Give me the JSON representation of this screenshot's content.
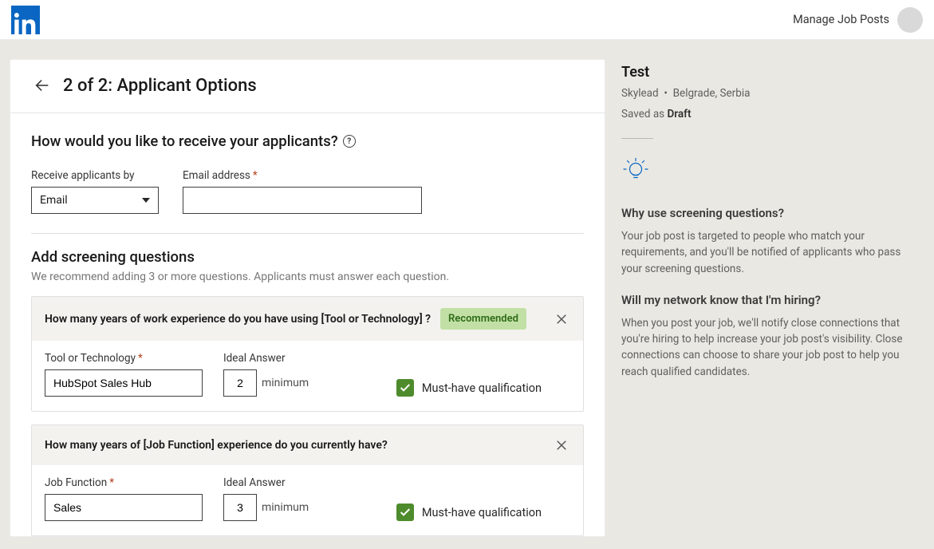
{
  "topbar": {
    "manage_label": "Manage Job Posts"
  },
  "header": {
    "title": "2 of 2: Applicant Options"
  },
  "receive_section": {
    "heading": "How would you like to receive your applicants?",
    "receive_label": "Receive applicants by",
    "receive_value": "Email",
    "email_label": "Email address",
    "email_value": ""
  },
  "screening_section": {
    "heading": "Add screening questions",
    "subtext": "We recommend adding 3 or more questions. Applicants must answer each question.",
    "recommended_badge": "Recommended",
    "minimum_label": "minimum",
    "must_have_label": "Must-have qualification",
    "questions": [
      {
        "question_text": "How many years of work experience do you have using [Tool or Technology] ?",
        "recommended": true,
        "field_label": "Tool or Technology",
        "field_value": "HubSpot Sales Hub",
        "ideal_label": "Ideal Answer",
        "ideal_value": "2",
        "must_have": true
      },
      {
        "question_text": "How many years of [Job Function] experience do you currently have?",
        "recommended": false,
        "field_label": "Job Function",
        "field_value": "Sales",
        "ideal_label": "Ideal Answer",
        "ideal_value": "3",
        "must_have": true
      }
    ]
  },
  "sidebar": {
    "job_title": "Test",
    "company": "Skylead",
    "dot": "•",
    "location": "Belgrade, Serbia",
    "saved_prefix": "Saved as ",
    "saved_status": "Draft",
    "info": [
      {
        "heading": "Why use screening questions?",
        "body": "Your job post is targeted to people who match your requirements, and you'll be notified of applicants who pass your screening questions."
      },
      {
        "heading": "Will my network know that I'm hiring?",
        "body": "When you post your job, we'll notify close connections that you're hiring to help increase your job post's visibility. Close connections can choose to share your job post to help you reach qualified candidates."
      }
    ]
  }
}
